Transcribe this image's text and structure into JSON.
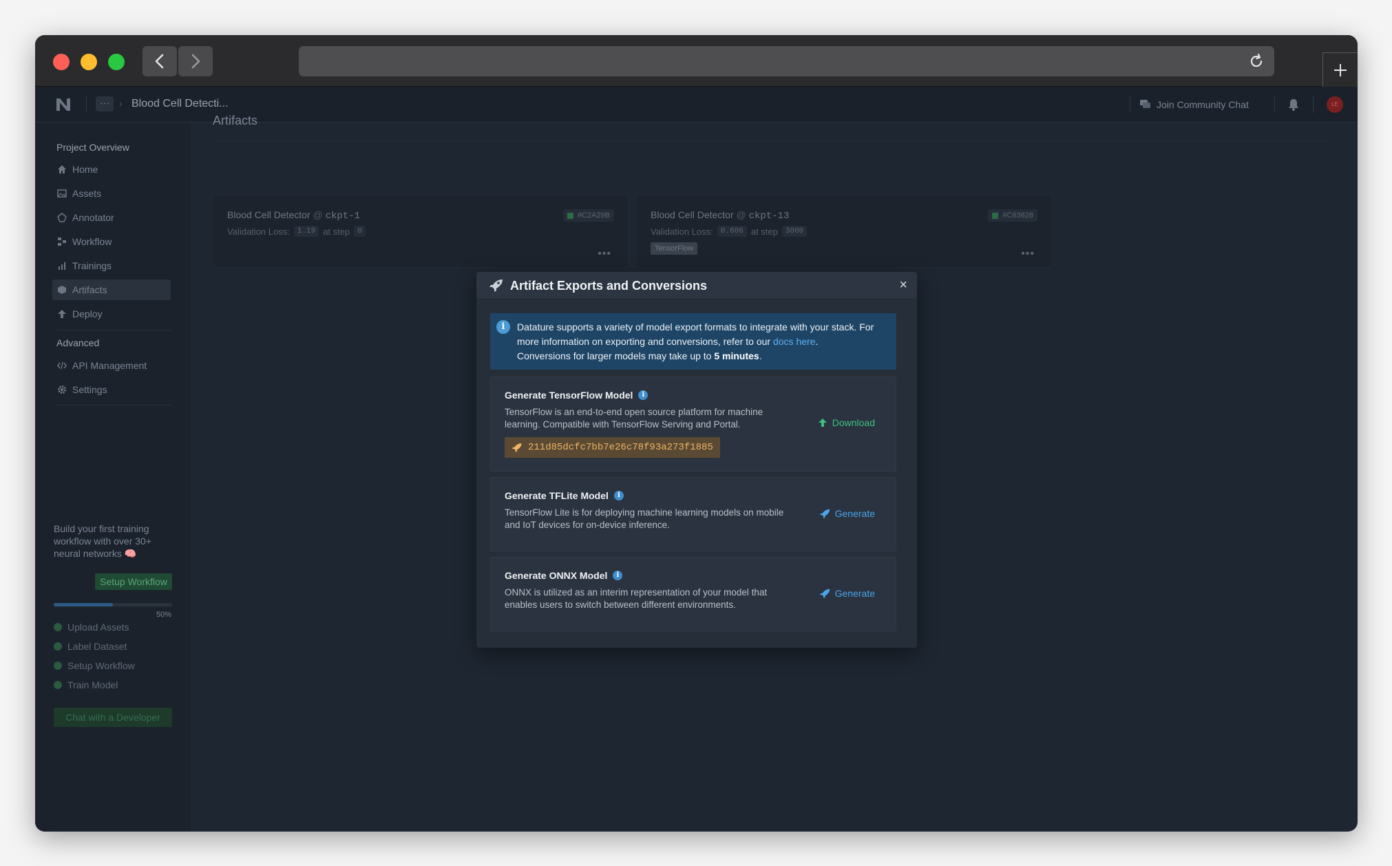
{
  "browser": {
    "back_icon": "chevron-left-icon",
    "forward_icon": "chevron-right-icon",
    "reload_icon": "reload-icon",
    "new_tab_icon": "plus-icon"
  },
  "topbar": {
    "logo_icon": "nexus-logo-icon",
    "more": "···",
    "breadcrumb_title": "Blood Cell Detecti...",
    "community": "Join Community Chat",
    "avatar_initials": "LE"
  },
  "sidebar": {
    "section_project": "Project Overview",
    "items": [
      {
        "label": "Home",
        "icon": "home-icon"
      },
      {
        "label": "Assets",
        "icon": "image-icon"
      },
      {
        "label": "Annotator",
        "icon": "annotator-icon"
      },
      {
        "label": "Workflow",
        "icon": "workflow-icon"
      },
      {
        "label": "Trainings",
        "icon": "chart-icon"
      },
      {
        "label": "Artifacts",
        "icon": "cube-icon",
        "active": true
      },
      {
        "label": "Deploy",
        "icon": "deploy-icon"
      }
    ],
    "section_advanced": "Advanced",
    "advanced_items": [
      {
        "label": "API Management",
        "icon": "code-icon"
      },
      {
        "label": "Settings",
        "icon": "gear-icon"
      }
    ],
    "onboarding_text": "Build your first training workflow with over 30+ neural networks 🧠",
    "setup_button": "Setup Workflow",
    "progress_value": 0.5,
    "progress_label": "50%",
    "steps": [
      "Upload Assets",
      "Label Dataset",
      "Setup Workflow",
      "Train Model"
    ],
    "chat_button": "Chat with a Developer"
  },
  "main": {
    "title": "Artifacts",
    "cards": [
      {
        "name": "Blood Cell Detector",
        "at": "@",
        "checkpoint": "ckpt-1",
        "loss_label": "Validation Loss:",
        "loss": "1.19",
        "step_label": "at step",
        "step": "0",
        "hash": "#C2A29B",
        "tag": ""
      },
      {
        "name": "Blood Cell Detector",
        "at": "@",
        "checkpoint": "ckpt-13",
        "loss_label": "Validation Loss:",
        "loss": "0.606",
        "step_label": "at step",
        "step": "3000",
        "hash": "#C63828",
        "tag": "TensorFlow"
      }
    ],
    "more": "•••"
  },
  "modal": {
    "title": "Artifact Exports and Conversions",
    "close": "×",
    "info_part1": "Datature supports a variety of model export formats to integrate with your stack. For more information on exporting and conversions, refer to our ",
    "info_link": "docs here",
    "info_part2": ".",
    "info_part3": "Conversions for larger models may take up to ",
    "info_bold": "5 minutes",
    "info_part4": ".",
    "options": [
      {
        "title": "Generate TensorFlow Model",
        "desc": "TensorFlow is an end-to-end open source platform for machine learning. Compatible with TensorFlow Serving and Portal.",
        "action": "Download",
        "hash": "211d85dcfc7bb7e26c78f93a273f1885"
      },
      {
        "title": "Generate TFLite Model",
        "desc": "TensorFlow Lite is for deploying machine learning models on mobile and IoT devices for on-device inference.",
        "action": "Generate"
      },
      {
        "title": "Generate ONNX Model",
        "desc": "ONNX is utilized as an interim representation of your model that enables users to switch between different environments.",
        "action": "Generate"
      }
    ]
  },
  "colors": {
    "accent_blue": "#4aa5e8",
    "accent_green": "#3fc17e",
    "hash_orange": "#f0b264",
    "info_bg": "#1f4566"
  }
}
